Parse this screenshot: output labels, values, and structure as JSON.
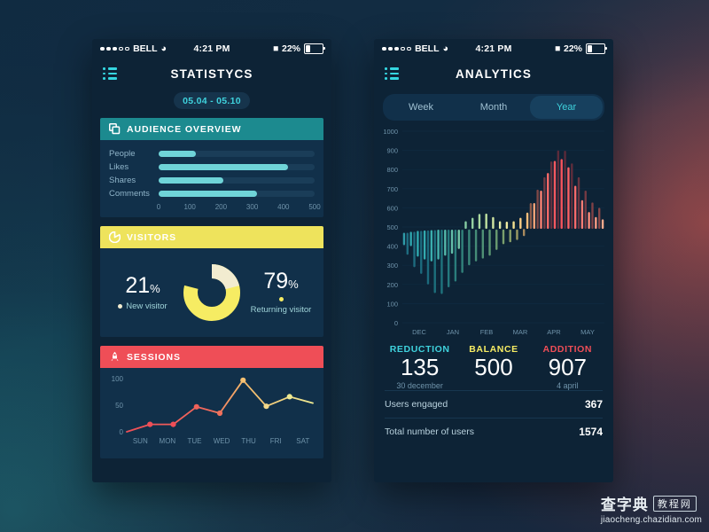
{
  "statusbar": {
    "carrier": "BELL",
    "time": "4:21 PM",
    "battery": "22%",
    "signal_filled": 3,
    "signal_empty": 2,
    "wifi_icon": "wifi-icon",
    "bluetooth_icon": "bluetooth-icon"
  },
  "left_phone": {
    "nav_title": "STATISTYCS",
    "menu_icon": "list-menu-icon",
    "date_range": "05.04 - 05.10",
    "audience": {
      "header": "AUDIENCE OVERVIEW",
      "icon": "layers-copy-icon",
      "header_color": "#1c8a8f",
      "bar_color": "#6fd4d8",
      "rows": [
        {
          "label": "People",
          "value": 118
        },
        {
          "label": "Likes",
          "value": 415
        },
        {
          "label": "Shares",
          "value": 208
        },
        {
          "label": "Comments",
          "value": 315
        }
      ],
      "axis_ticks": [
        0,
        100,
        200,
        300,
        400,
        500
      ],
      "axis_max": 500
    },
    "visitors": {
      "header": "VISITORS",
      "icon": "pie-chart-icon",
      "header_color": "#eee35c",
      "new_pct": "21",
      "new_label": "New visitor",
      "new_color": "#f2ecd0",
      "returning_pct": "79",
      "returning_label": "Returning visitor",
      "returning_color": "#f6ec63",
      "pct_symbol": "%"
    },
    "sessions": {
      "header": "SESSIONS",
      "icon": "rocket-icon",
      "header_color": "#ef4e57",
      "y_ticks": [
        0,
        50,
        100
      ],
      "y_max": 100,
      "days": [
        "SUN",
        "MON",
        "TUE",
        "WED",
        "THU",
        "FRI",
        "SAT"
      ],
      "values": [
        0,
        14,
        14,
        47,
        35,
        97,
        48,
        66,
        54
      ]
    }
  },
  "right_phone": {
    "nav_title": "ANALYTICS",
    "menu_icon": "list-menu-icon",
    "segments": [
      {
        "label": "Week",
        "active": false
      },
      {
        "label": "Month",
        "active": false
      },
      {
        "label": "Year",
        "active": true
      }
    ],
    "stats": [
      {
        "key": "REDUCTION",
        "key_color": "#3fd2dd",
        "value": "135",
        "sub": "30 december"
      },
      {
        "key": "BALANCE",
        "key_color": "#f6ec63",
        "value": "500",
        "sub": ""
      },
      {
        "key": "ADDITION",
        "key_color": "#ef4e57",
        "value": "907",
        "sub": "4 april"
      }
    ],
    "list": [
      {
        "label": "Users engaged",
        "value": "367"
      },
      {
        "label": "Total number of users",
        "value": "1574"
      }
    ]
  },
  "chart_data": {
    "type": "bar",
    "title": "ANALYTICS",
    "xlabel": "",
    "ylabel": "",
    "ylim": [
      0,
      1000
    ],
    "y_ticks": [
      0,
      100,
      200,
      300,
      400,
      500,
      600,
      700,
      800,
      900,
      1000
    ],
    "grid": true,
    "baseline": 500,
    "categories": [
      "DEC",
      "JAN",
      "FEB",
      "MAR",
      "APR",
      "MAY"
    ],
    "note": "Floating bars: each bar spans from 'low' to 'high'. Bars alternate bright (front) and dark (shadow) tones.",
    "bars": [
      {
        "low": 405,
        "high": 470,
        "color": "#2f9ba8",
        "shade": false
      },
      {
        "low": 355,
        "high": 470,
        "color": "#1e6d80",
        "shade": true
      },
      {
        "low": 400,
        "high": 475,
        "color": "#2fa6ad",
        "shade": false
      },
      {
        "low": 290,
        "high": 475,
        "color": "#1d6b7e",
        "shade": true
      },
      {
        "low": 345,
        "high": 480,
        "color": "#2fa8ae",
        "shade": false
      },
      {
        "low": 255,
        "high": 480,
        "color": "#1c6a7d",
        "shade": true
      },
      {
        "low": 330,
        "high": 482,
        "color": "#33aaae",
        "shade": false
      },
      {
        "low": 200,
        "high": 482,
        "color": "#1b6a7c",
        "shade": true
      },
      {
        "low": 320,
        "high": 484,
        "color": "#3aaeae",
        "shade": false
      },
      {
        "low": 155,
        "high": 484,
        "color": "#1d6f7c",
        "shade": true
      },
      {
        "low": 330,
        "high": 486,
        "color": "#45b4ae",
        "shade": false
      },
      {
        "low": 150,
        "high": 486,
        "color": "#1f737d",
        "shade": true
      },
      {
        "low": 350,
        "high": 486,
        "color": "#54b9ab",
        "shade": false
      },
      {
        "low": 185,
        "high": 486,
        "color": "#24787d",
        "shade": true
      },
      {
        "low": 360,
        "high": 486,
        "color": "#63bfa9",
        "shade": false
      },
      {
        "low": 215,
        "high": 486,
        "color": "#2a7d7c",
        "shade": true
      },
      {
        "low": 385,
        "high": 486,
        "color": "#74c6a6",
        "shade": false
      },
      {
        "low": 260,
        "high": 486,
        "color": "#31827b",
        "shade": true
      },
      {
        "low": 490,
        "high": 530,
        "color": "#86cda3",
        "shade": false
      },
      {
        "low": 300,
        "high": 487,
        "color": "#3a8779",
        "shade": true
      },
      {
        "low": 490,
        "high": 548,
        "color": "#96d2a1",
        "shade": false
      },
      {
        "low": 320,
        "high": 487,
        "color": "#458c77",
        "shade": true
      },
      {
        "low": 490,
        "high": 568,
        "color": "#a9d99e",
        "shade": false
      },
      {
        "low": 335,
        "high": 487,
        "color": "#4f9175",
        "shade": true
      },
      {
        "low": 490,
        "high": 570,
        "color": "#bee0a0",
        "shade": false
      },
      {
        "low": 350,
        "high": 487,
        "color": "#5b9673",
        "shade": true
      },
      {
        "low": 490,
        "high": 552,
        "color": "#d2e7a2",
        "shade": false
      },
      {
        "low": 380,
        "high": 487,
        "color": "#6a9b70",
        "shade": true
      },
      {
        "low": 490,
        "high": 530,
        "color": "#e2eba6",
        "shade": false
      },
      {
        "low": 410,
        "high": 487,
        "color": "#7a9f6d",
        "shade": true
      },
      {
        "low": 490,
        "high": 528,
        "color": "#eeeaa2",
        "shade": false
      },
      {
        "low": 420,
        "high": 487,
        "color": "#8a9f68",
        "shade": true
      },
      {
        "low": 490,
        "high": 530,
        "color": "#f4e190",
        "shade": false
      },
      {
        "low": 432,
        "high": 487,
        "color": "#9c9a63",
        "shade": true
      },
      {
        "low": 490,
        "high": 548,
        "color": "#f9cd84",
        "shade": false
      },
      {
        "low": 452,
        "high": 490,
        "color": "#a98a5e",
        "shade": true
      },
      {
        "low": 490,
        "high": 575,
        "color": "#fbbd7a",
        "shade": false
      },
      {
        "low": 490,
        "high": 625,
        "color": "#8f5c4c",
        "shade": true
      },
      {
        "low": 490,
        "high": 625,
        "color": "#fca378",
        "shade": false
      },
      {
        "low": 490,
        "high": 695,
        "color": "#7e4746",
        "shade": true
      },
      {
        "low": 490,
        "high": 690,
        "color": "#fb8272",
        "shade": false
      },
      {
        "low": 490,
        "high": 760,
        "color": "#6f3a44",
        "shade": true
      },
      {
        "low": 490,
        "high": 782,
        "color": "#fa6a68",
        "shade": false
      },
      {
        "low": 490,
        "high": 842,
        "color": "#63313f",
        "shade": true
      },
      {
        "low": 490,
        "high": 845,
        "color": "#f9585f",
        "shade": false
      },
      {
        "low": 490,
        "high": 900,
        "color": "#5c2b3b",
        "shade": true
      },
      {
        "low": 490,
        "high": 855,
        "color": "#f9545c",
        "shade": false
      },
      {
        "low": 490,
        "high": 898,
        "color": "#5a2a3a",
        "shade": true
      },
      {
        "low": 490,
        "high": 812,
        "color": "#fa5f63",
        "shade": false
      },
      {
        "low": 490,
        "high": 832,
        "color": "#5f2d3c",
        "shade": true
      },
      {
        "low": 490,
        "high": 715,
        "color": "#fa6a6a",
        "shade": false
      },
      {
        "low": 490,
        "high": 760,
        "color": "#6a3440",
        "shade": true
      },
      {
        "low": 490,
        "high": 640,
        "color": "#fb7c74",
        "shade": false
      },
      {
        "low": 490,
        "high": 690,
        "color": "#753a43",
        "shade": true
      },
      {
        "low": 490,
        "high": 578,
        "color": "#fb8d7c",
        "shade": false
      },
      {
        "low": 490,
        "high": 628,
        "color": "#7f4146",
        "shade": true
      },
      {
        "low": 490,
        "high": 552,
        "color": "#fc9d84",
        "shade": false
      },
      {
        "low": 490,
        "high": 600,
        "color": "#884749",
        "shade": true
      },
      {
        "low": 490,
        "high": 540,
        "color": "#fcaa8c",
        "shade": false
      }
    ]
  },
  "watermark": {
    "cn_text": "查字典",
    "cn_box": "教程网",
    "url": "jiaocheng.chazidian.com"
  }
}
